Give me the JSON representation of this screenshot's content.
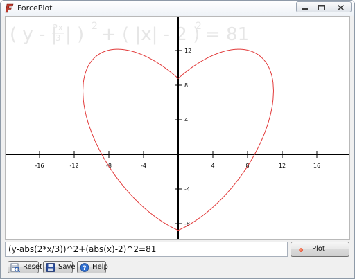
{
  "window": {
    "title": "ForcePlot"
  },
  "formula_display": {
    "y_part": "( y - |",
    "frac_num": "2x",
    "frac_den": "3",
    "after_frac": "| )",
    "sq1": "2",
    "plus_part": "+ ( |x| - 2 )",
    "sq2": "2",
    "eq_part": "= 81"
  },
  "axes": {
    "x_ticks": [
      "-16",
      "-12",
      "-8",
      "-4",
      "4",
      "8",
      "12",
      "16"
    ],
    "y_ticks": [
      "12",
      "8",
      "4",
      "-4",
      "-8"
    ]
  },
  "curve": {
    "color": "#e23a3a"
  },
  "expression": {
    "value": "(y-abs(2*x/3))^2+(abs(x)-2)^2=81"
  },
  "buttons": {
    "plot": "Plot",
    "reset": "Reset",
    "save": "Save",
    "help": "Help"
  }
}
